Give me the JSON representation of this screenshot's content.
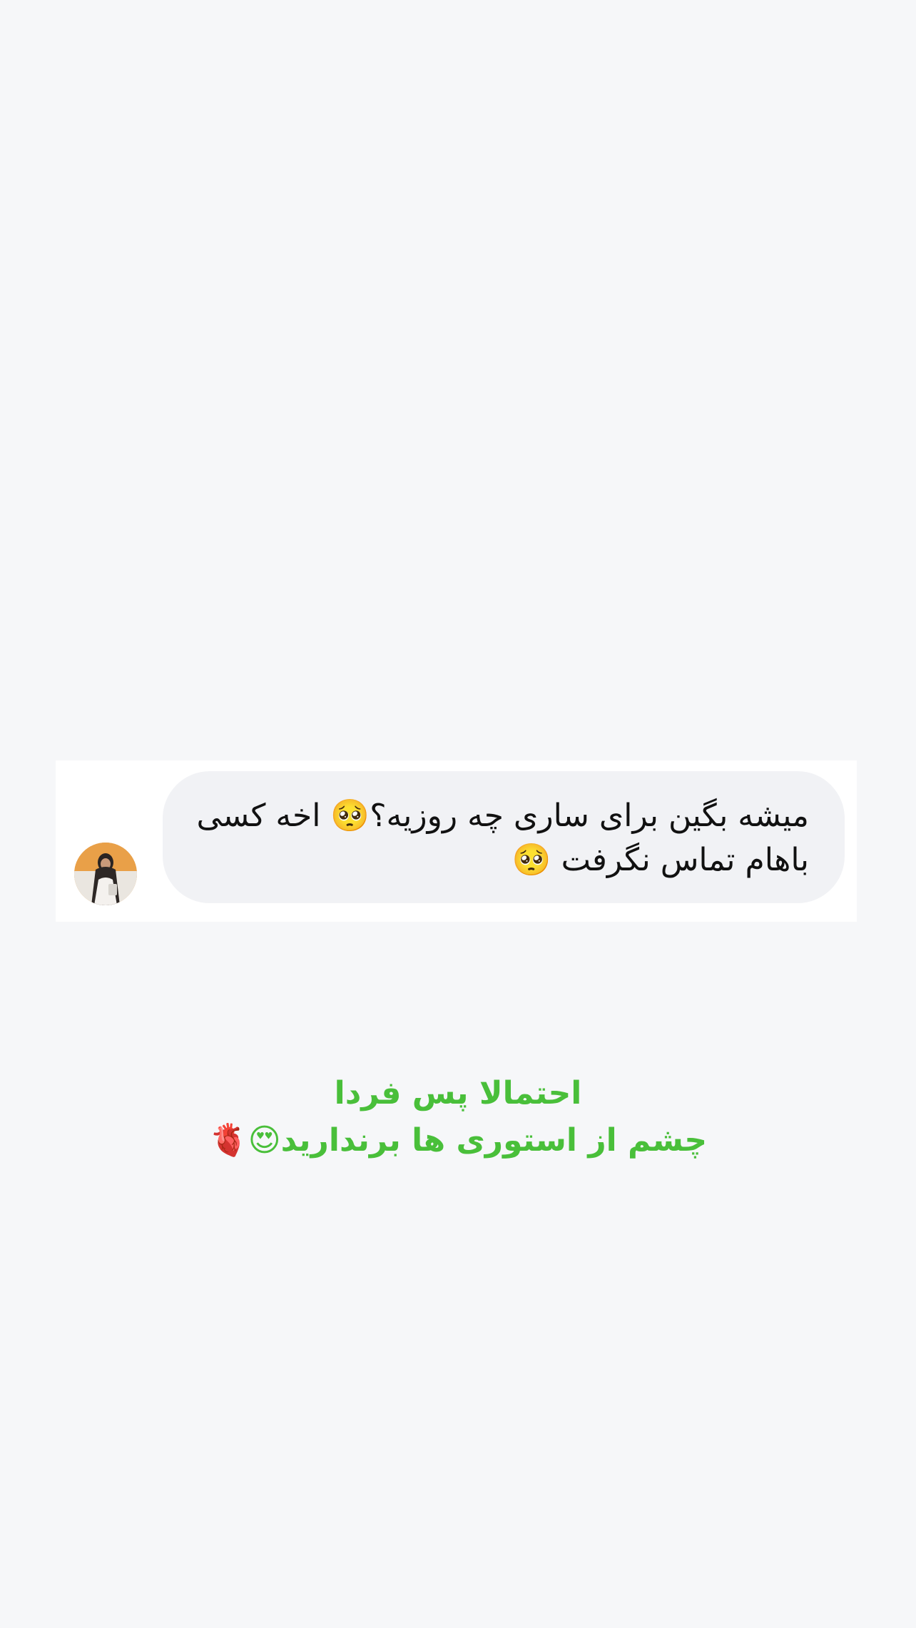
{
  "comment": {
    "avatar": "avatar",
    "text": "میشه بگین برای ساری چه روزیه؟🥺 اخه کسی باهام تماس نگرفت 🥺"
  },
  "announcement": {
    "line1": "احتمالا پس فردا",
    "line2": "چشم از استوری ها برندارید😍🫀"
  },
  "colors": {
    "background": "#f6f7f9",
    "bubble": "#f1f2f5",
    "card": "#ffffff",
    "announcement_text": "#49bf3a",
    "comment_text": "#111111"
  }
}
